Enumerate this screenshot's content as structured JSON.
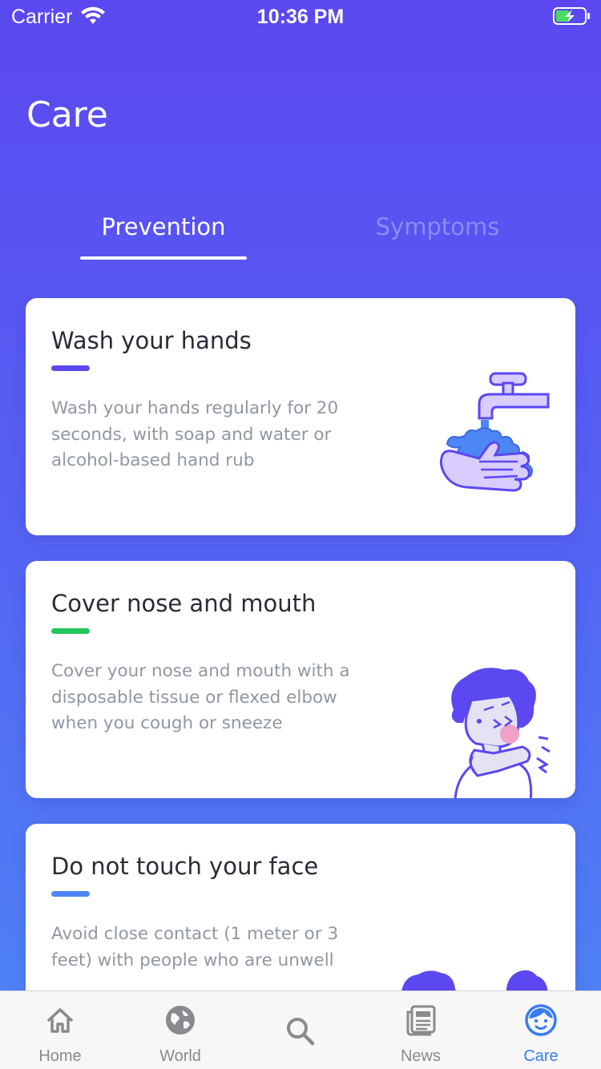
{
  "status_bar": {
    "carrier": "Carrier",
    "time": "10:36 PM",
    "icons": [
      "wifi-icon",
      "battery-charging-icon"
    ]
  },
  "screen": {
    "title": "Care"
  },
  "tabs": [
    {
      "label": "Prevention",
      "selected": true
    },
    {
      "label": "Symptoms",
      "selected": false
    }
  ],
  "cards": [
    {
      "title": "Wash your hands",
      "description": "Wash your hands regularly for 20 seconds, with soap and water or alcohol-based hand rub",
      "accent_color": "#5B48F0",
      "illustration": "hand-washing-illustration"
    },
    {
      "title": "Cover nose and mouth",
      "description": "Cover your nose and mouth with a disposable tissue or flexed elbow when you cough or sneeze",
      "accent_color": "#22C55E",
      "illustration": "sneeze-into-elbow-illustration"
    },
    {
      "title": "Do not touch your face",
      "description": "Avoid close contact (1 meter or 3 feet) with people who are unwell",
      "accent_color": "#4D86F6",
      "illustration": "avoid-contact-illustration"
    }
  ],
  "tab_bar": {
    "items": [
      {
        "label": "Home",
        "icon": "home-icon",
        "active": false
      },
      {
        "label": "World",
        "icon": "globe-icon",
        "active": false
      },
      {
        "label": "",
        "icon": "search-icon",
        "active": false
      },
      {
        "label": "News",
        "icon": "news-icon",
        "active": false
      },
      {
        "label": "Care",
        "icon": "care-face-icon",
        "active": true
      }
    ]
  },
  "colors": {
    "primary": "#5B48F0",
    "gradient_end": "#4D86F6",
    "active_tab": "#3A7CF0",
    "inactive_tab": "#8A8A8E"
  }
}
